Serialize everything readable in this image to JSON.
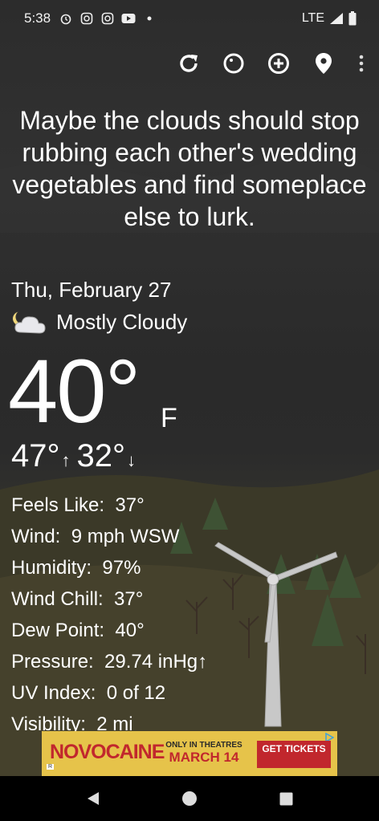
{
  "status_bar": {
    "time": "5:38",
    "network": "LTE",
    "notification_icons": [
      "alarm-icon",
      "instagram-icon",
      "instagram-icon",
      "youtube-icon",
      "dot-icon"
    ]
  },
  "toolbar": {
    "buttons": [
      "refresh-icon",
      "theme-icon",
      "add-location-icon",
      "location-pin-icon",
      "more-vert-icon"
    ]
  },
  "quote": "Maybe the clouds should stop rubbing each other's wedding vegetables and find someplace else to lurk.",
  "weather": {
    "date": "Thu, February 27",
    "condition": "Mostly Cloudy",
    "condition_icon": "partly-cloudy-night-icon",
    "temperature": "40°",
    "unit": "F",
    "high": "47°",
    "high_arrow": "↑",
    "low": "32°",
    "low_arrow": "↓"
  },
  "details": [
    {
      "label": "Feels Like:",
      "value": "37°"
    },
    {
      "label": "Wind:",
      "value": "9 mph WSW"
    },
    {
      "label": "Humidity:",
      "value": "97%"
    },
    {
      "label": "Wind Chill:",
      "value": "37°"
    },
    {
      "label": "Dew Point:",
      "value": "40°"
    },
    {
      "label": "Pressure:",
      "value": "29.74 inHg↑"
    },
    {
      "label": "UV Index:",
      "value": "0 of 12"
    },
    {
      "label": "Visibility:",
      "value": "2 mi"
    }
  ],
  "ad": {
    "brand": "NOVOCAINE",
    "tagline": "ONLY IN THEATRES",
    "release_date": "MARCH 14",
    "cta": "GET TICKETS",
    "rating": "R"
  },
  "colors": {
    "ad_background": "#e6c34a",
    "ad_red": "#c1272d",
    "sky": "#2c2c2c"
  }
}
